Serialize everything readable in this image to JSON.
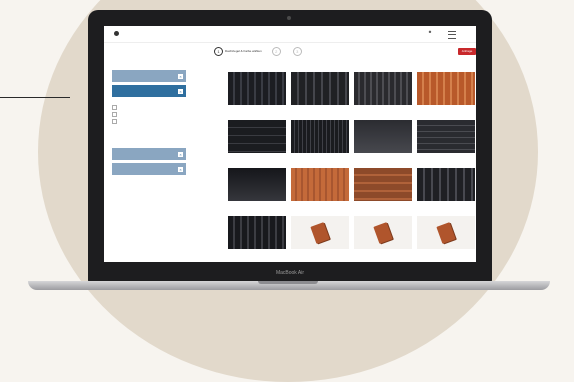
{
  "laptop": {
    "brand_label": "MacBook Air"
  },
  "app": {
    "steps": [
      {
        "number": "1",
        "label": "Dachziegel & Farbe wählen",
        "active": true
      },
      {
        "number": "2",
        "label": "",
        "active": false
      },
      {
        "number": "3",
        "label": "",
        "active": false
      }
    ],
    "cta_label": "Anfrage"
  },
  "sidebar": {
    "filters": [
      {
        "label": "",
        "active": false
      },
      {
        "label": "",
        "active": true
      }
    ],
    "heading_1": "",
    "heading_2": "",
    "checkboxes": [
      "",
      "",
      ""
    ],
    "filters_2": [
      {
        "label": "",
        "active": false
      },
      {
        "label": "",
        "active": false
      }
    ],
    "footer": ""
  },
  "products": [
    {
      "name": "",
      "price": ""
    },
    {
      "name": "",
      "price": ""
    },
    {
      "name": "",
      "price": ""
    },
    {
      "name": "",
      "price": ""
    },
    {
      "name": "",
      "price": ""
    },
    {
      "name": "",
      "price": ""
    },
    {
      "name": "",
      "price": ""
    },
    {
      "name": "",
      "price": ""
    },
    {
      "name": "",
      "price": ""
    },
    {
      "name": "",
      "price": ""
    },
    {
      "name": "",
      "price": ""
    },
    {
      "name": "",
      "price": ""
    },
    {
      "name": "",
      "price": ""
    },
    {
      "name": "",
      "price": ""
    },
    {
      "name": "",
      "price": ""
    },
    {
      "name": "",
      "price": ""
    }
  ],
  "colors": {
    "accent": "#c8282b",
    "sidebar_active": "#2f6f9f",
    "sidebar_inactive": "#8aa6c1",
    "price": "#5a8fc0"
  }
}
